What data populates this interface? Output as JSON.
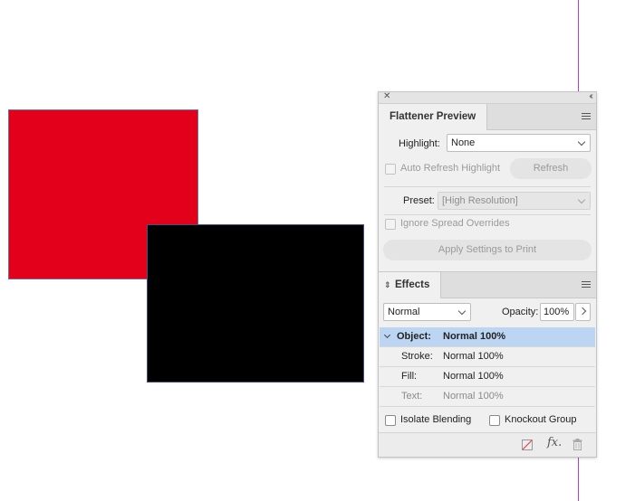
{
  "canvas": {
    "red_color": "#e2001a",
    "black_color": "#000000",
    "guide_color": "#b43cc8"
  },
  "panel": {
    "flattener": {
      "tab_title": "Flattener Preview",
      "highlight_label": "Highlight:",
      "highlight_value": "None",
      "auto_refresh_label": "Auto Refresh Highlight",
      "refresh_button": "Refresh",
      "preset_label": "Preset:",
      "preset_value": "[High Resolution]",
      "ignore_overrides_label": "Ignore Spread Overrides",
      "apply_button": "Apply Settings to Print"
    },
    "effects": {
      "tab_title": "Effects",
      "blend_mode": "Normal",
      "opacity_label": "Opacity:",
      "opacity_value": "100%",
      "rows": [
        {
          "key": "Object:",
          "value": "Normal 100%"
        },
        {
          "key": "Stroke:",
          "value": "Normal 100%"
        },
        {
          "key": "Fill:",
          "value": "Normal 100%"
        },
        {
          "key": "Text:",
          "value": "Normal 100%"
        }
      ],
      "isolate_label": "Isolate Blending",
      "knockout_label": "Knockout Group",
      "fx_label": "fx."
    }
  }
}
